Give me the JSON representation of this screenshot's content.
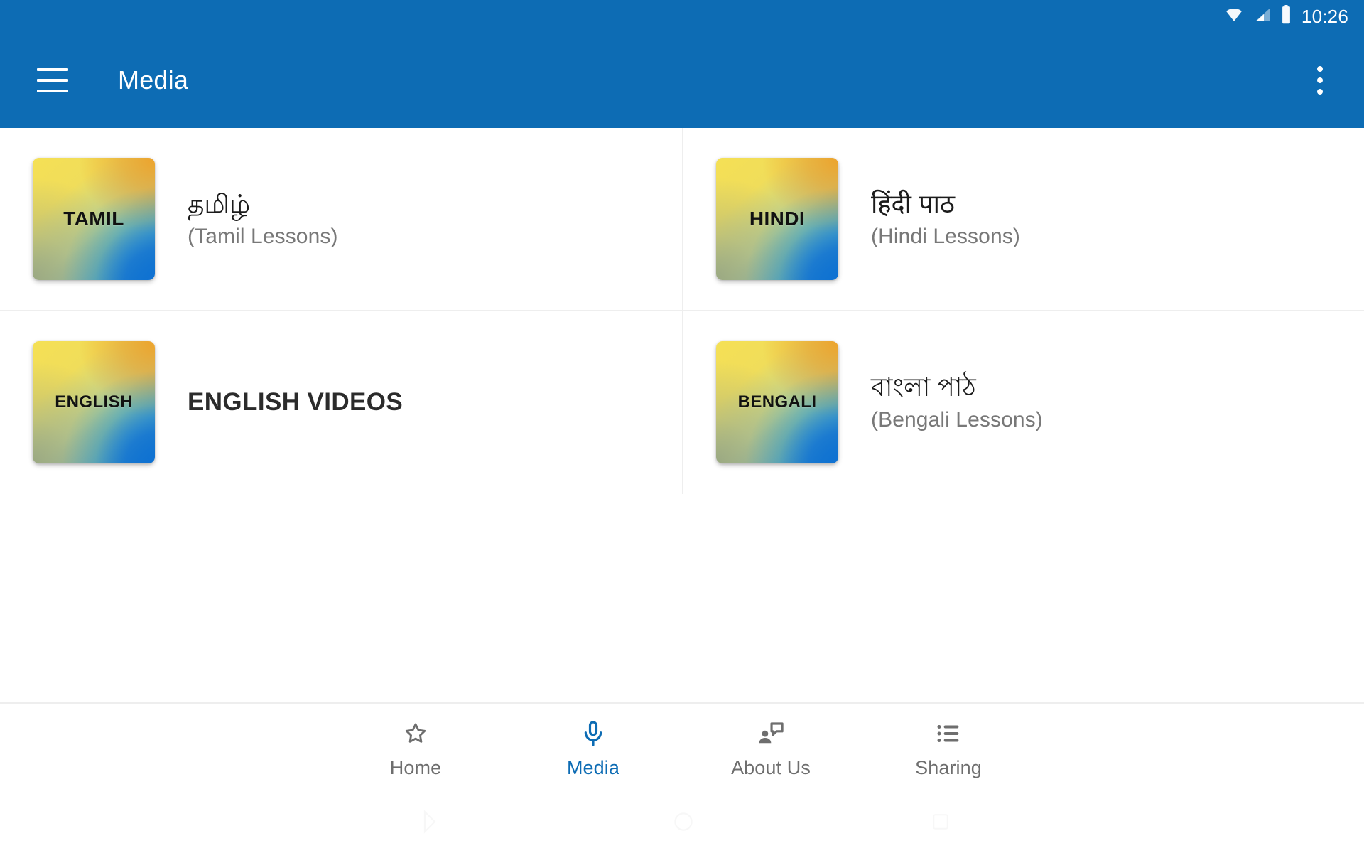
{
  "status_bar": {
    "time": "10:26",
    "icons": [
      "wifi-icon",
      "cellular-signal-icon",
      "battery-icon"
    ],
    "background_color": "#0d6cb4"
  },
  "toolbar": {
    "title": "Media",
    "menu_icon": "hamburger-menu-icon",
    "overflow_icon": "overflow-menu-icon",
    "background_color": "#0d6cb4",
    "text_color": "#ffffff"
  },
  "grid": {
    "items": [
      {
        "tile_label": "TAMIL",
        "title": "தமிழ்",
        "subtitle": "(Tamil Lessons)",
        "caps": false
      },
      {
        "tile_label": "HINDI",
        "title": "हिंदी पाठ",
        "subtitle": "(Hindi Lessons)",
        "caps": false
      },
      {
        "tile_label": "ENGLISH",
        "title": "ENGLISH VIDEOS",
        "subtitle": "",
        "caps": true
      },
      {
        "tile_label": "BENGALI",
        "title": "বাংলা পাঠ",
        "subtitle": "(Bengali Lessons)",
        "caps": false
      }
    ],
    "tile_gradient_colors": [
      "#f5e055",
      "#eda32c",
      "#9aa882",
      "#1272c8"
    ],
    "divider_color": "#eeeeee"
  },
  "bottom_nav": {
    "active_color": "#0d6cb4",
    "inactive_color": "#6e6e6e",
    "items": [
      {
        "label": "Home",
        "icon": "star-outline-icon",
        "active": false
      },
      {
        "label": "Media",
        "icon": "microphone-icon",
        "active": true
      },
      {
        "label": "About Us",
        "icon": "person-speech-bubble-icon",
        "active": false
      },
      {
        "label": "Sharing",
        "icon": "bulleted-list-icon",
        "active": false
      }
    ]
  },
  "system_nav": {
    "buttons": [
      "back-triangle-icon",
      "home-circle-icon",
      "recents-square-icon"
    ]
  }
}
